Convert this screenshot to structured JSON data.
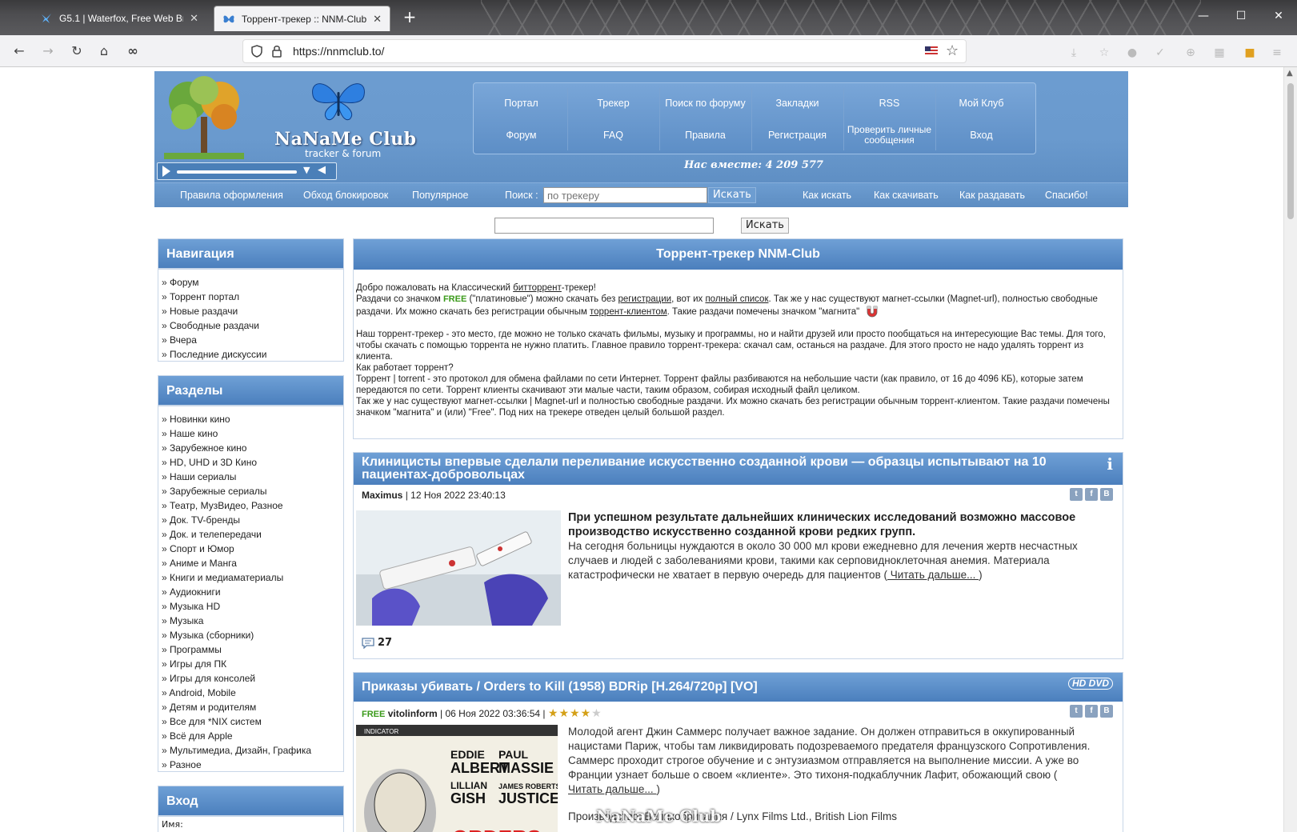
{
  "browser": {
    "tabs": [
      {
        "title": "G5.1 | Waterfox, Free Web Brow",
        "close": "✕"
      },
      {
        "title": "Торрент-трекер :: NNM-Club",
        "close": "✕"
      }
    ],
    "new_tab": "+",
    "url": "https://nnmclub.to/",
    "window": {
      "minimize": "—",
      "maximize": "☐",
      "close": "✕"
    },
    "nav_icons": [
      "back-icon",
      "forward-icon",
      "reload-icon",
      "home-icon",
      "infinity-icon"
    ],
    "toolbar_icons": [
      "download-icon",
      "bookmarks-icon",
      "extension-icon",
      "menu-icon"
    ]
  },
  "site": {
    "logo_text": "NaNaMe Club",
    "logo_sub": "tracker & forum",
    "menu_row1": [
      "Портал",
      "Трекер",
      "Поиск по форуму",
      "Закладки",
      "RSS",
      "Мой Клуб"
    ],
    "menu_row2": [
      "Форум",
      "FAQ",
      "Правила",
      "Регистрация",
      "Проверить личные сообщения",
      "Вход"
    ],
    "together": "Нас вместе: 4 209 577",
    "subbar": {
      "links_left": [
        "Правила оформления",
        "Обход блокировок",
        "Популярное"
      ],
      "search_label": "Поиск :",
      "search_placeholder": "по трекеру",
      "search_button": "Искать",
      "links_right": [
        "Как искать",
        "Как скачивать",
        "Как раздавать",
        "Спасибо!"
      ]
    },
    "top_search_button": "Искать",
    "watermark": "NaNaMe Club"
  },
  "sidebar": {
    "nav_title": "Навигация",
    "nav_items": [
      "Форум",
      "Торрент портал",
      "Новые раздачи",
      "Свободные раздачи",
      "Вчера",
      "Последние дискуссии"
    ],
    "sections_title": "Разделы",
    "section_items": [
      "Новинки кино",
      "Наше кино",
      "Зарубежное кино",
      "HD, UHD и 3D Кино",
      "Наши сериалы",
      "Зарубежные сериалы",
      "Театр, МузВидео, Разное",
      "Док. TV-бренды",
      "Док. и телепередачи",
      "Спорт и Юмор",
      "Аниме и Манга",
      "Книги и медиаматериалы",
      "Аудиокниги",
      "Музыка HD",
      "Музыка",
      "Музыка (сборники)",
      "Программы",
      "Игры для ПК",
      "Игры для консолей",
      "Android, Mobile",
      "Детям и родителям",
      "Все для *NIX систем",
      "Всё для Apple",
      "Мультимедиа, Дизайн, Графика",
      "Разное"
    ],
    "login_title": "Вход",
    "login_label": "Имя:"
  },
  "main": {
    "title": "Торрент-трекер NNM-Club",
    "welcome": {
      "p1a": "Добро пожаловать на Классический ",
      "p1link": "битторрент",
      "p1b": "-трекер!",
      "p2a": "Раздачи со значком ",
      "free": "FREE",
      "p2b": " (\"платиновые\") можно скачать без ",
      "p2link1": "регистрации",
      "p2c": ", вот их ",
      "p2link2": "полный список",
      "p2d": ". Так же у нас существуют магнет-ссылки (Magnet-url), полностью свободные раздачи. Их можно скачать без регистрации обычным ",
      "p2link3": "торрент-клиентом",
      "p2e": ". Такие раздачи помечены значком \"магнита\"",
      "p3": "Наш торрент-трекер - это место, где можно не только скачать фильмы, музыку и программы, но и найти друзей или просто пообщаться на интересующие Вас темы. Для того, чтобы скачать с помощью торрента не нужно платить. Главное правило торрент-трекера: скачал сам, останься на раздаче. Для этого просто не надо удалять торрент из клиента.",
      "p4": "Как работает торрент?",
      "p5": "Торрент | torrent - это протокол для обмена файлами по сети Интернет. Торрент файлы разбиваются на небольшие части (как правило, от 16 до 4096 КБ), которые затем передаются по сети. Торрент клиенты скачивают эти малые части, таким образом, собирая исходный файл целиком.",
      "p6": "Так же у нас существуют магнет-ссылки | Magnet-url и полностью свободные раздачи. Их можно скачать без регистрации обычным торрент-клиентом. Такие раздачи помечены значком \"магнита\" и (или) \"Free\". Под них на трекере отведен целый большой раздел."
    },
    "news1": {
      "title": "Клиницисты впервые сделали переливание искусственно созданной крови — образцы испытывают на 10 пациентах-добровольцах",
      "author": "Maximus",
      "date": "| 12 Ноя 2022 23:40:13",
      "lead": "При успешном результате дальнейших клинических исследований возможно массовое производство искусственно созданной крови редких групп.",
      "body": "На сегодня больницы нуждаются в около 30 000 мл крови ежедневно для лечения жертв несчастных случаев и людей с заболеваниями крови, такими как серповидноклеточная анемия. Материала катастрофически не хватает в первую очередь для пациентов (",
      "more": " Читать дальше... ",
      "more_close": ")",
      "comments": "27"
    },
    "news2": {
      "title": "Приказы убивать / Orders to Kill (1958) BDRip [H.264/720p] [VO]",
      "badge": "HD DVD",
      "free": "FREE",
      "author": "vitolinform",
      "date": "| 06 Ноя 2022 03:36:54 |",
      "rating": 4,
      "rating_max": 5,
      "body": "Молодой агент Джин Саммерс получает важное задание. Он должен отправиться в оккупированный нацистами Париж, чтобы там ликвидировать подозреваемого предателя французского Сопротивления. Саммерс проходит строгое обучение и с энтузиазмом отправляется на выполнение миссии. А уже во Франции узнает больше о своем «клиенте». Это тихоня-подкаблучник Лафит, обожающий свою (",
      "more": "Читать дальше... ",
      "more_close": ")",
      "production": "Производство: Великобритания / Lynx Films Ltd., British Lion Films"
    }
  }
}
